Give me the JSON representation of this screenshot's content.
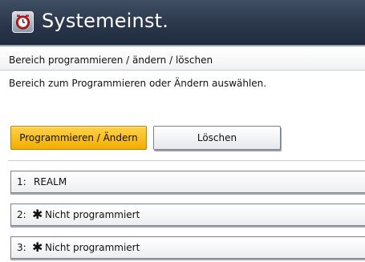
{
  "window": {
    "title": "Systemeinst.",
    "icon": "clock-settings-icon"
  },
  "subheader": {
    "text": "Bereich programmieren / ändern / löschen"
  },
  "instruction": "Bereich zum Programmieren oder Ändern auswählen.",
  "tabs": [
    {
      "label": "Programmieren / Ändern",
      "selected": true
    },
    {
      "label": "Löschen",
      "selected": false
    }
  ],
  "realms": [
    {
      "number": "1",
      "separator": ":",
      "mark": "",
      "name": "REALM"
    },
    {
      "number": "2",
      "separator": ":",
      "mark": "✱",
      "name": "Nicht programmiert"
    },
    {
      "number": "3",
      "separator": ":",
      "mark": "✱",
      "name": "Nicht programmiert"
    }
  ],
  "colors": {
    "titlebar": "#2a374b",
    "active_tab": "#f2ad00",
    "text": "#111111"
  }
}
